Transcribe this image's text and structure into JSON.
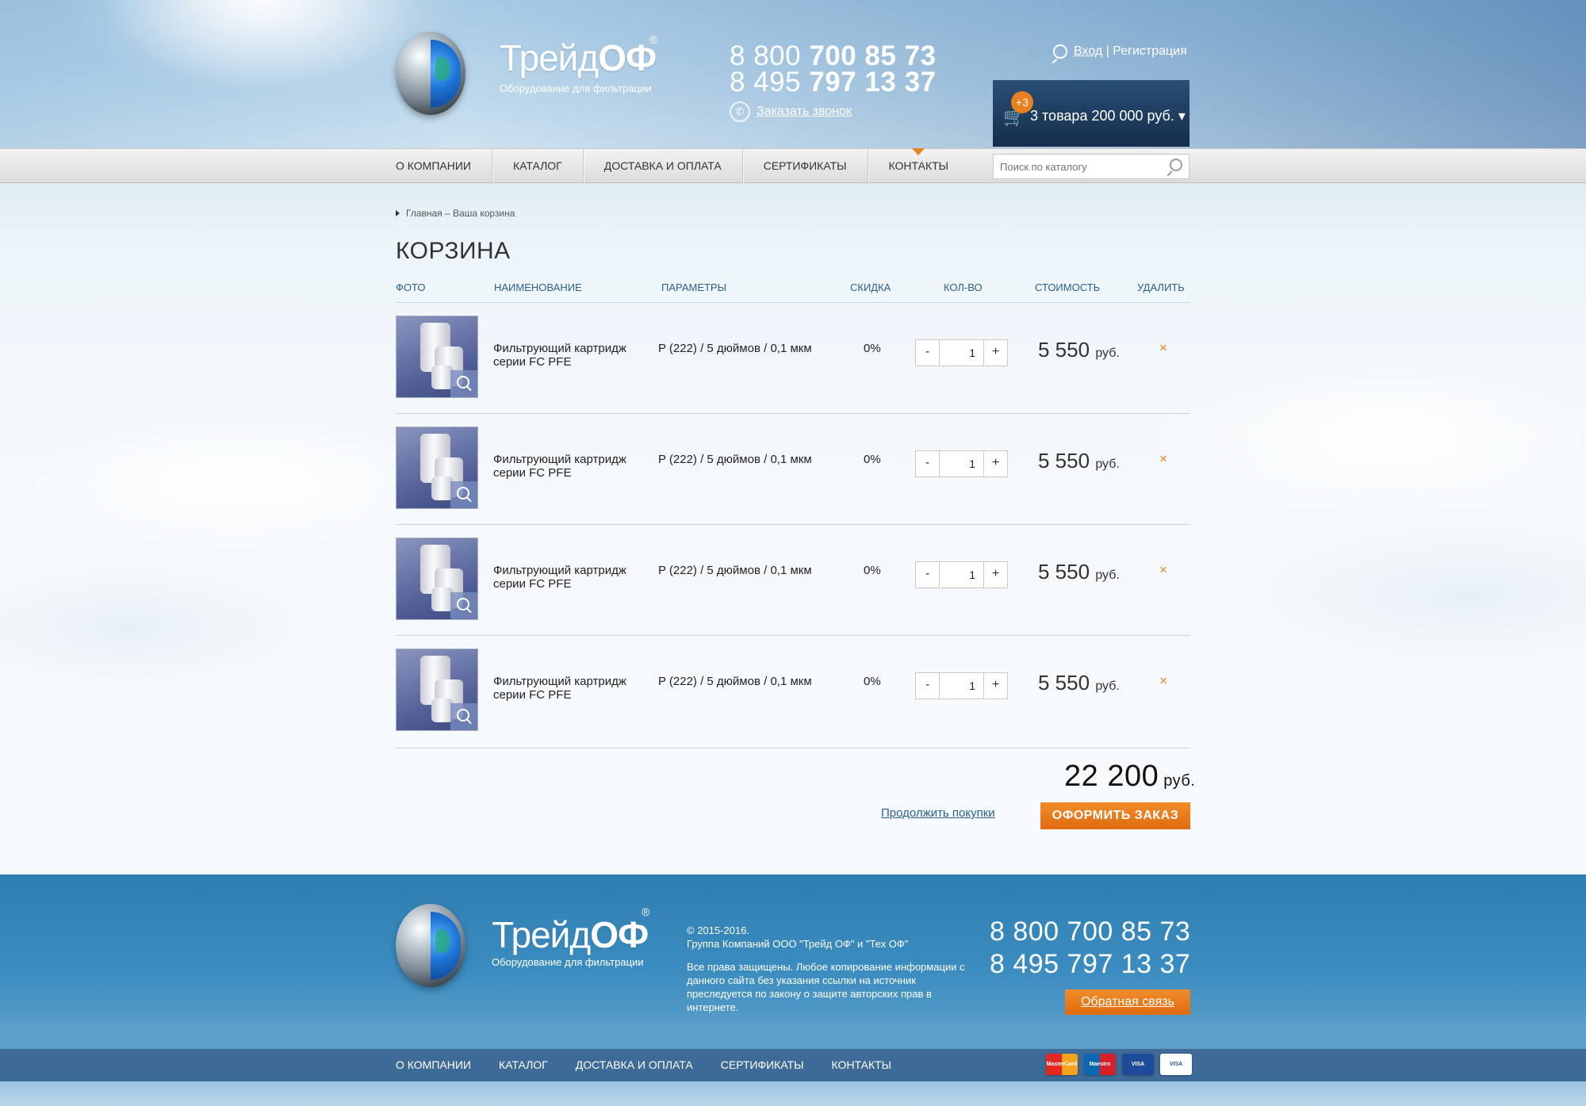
{
  "header": {
    "logo": {
      "brand_light": "Трейд",
      "brand_bold": "ОФ",
      "reg": "®",
      "subtitle": "Оборудование для фильтрации"
    },
    "phones": [
      {
        "light": "8 800 ",
        "bold": "700 85 73"
      },
      {
        "light": "8 495 ",
        "bold": "797 13 37"
      }
    ],
    "callback_label": "Заказать звонок",
    "auth": {
      "login": "Вход",
      "separator": " | ",
      "register": "Регистрация"
    },
    "cart": {
      "badge": "+3",
      "summary": "3 товара 200 000 руб. ▾"
    }
  },
  "nav": {
    "items": [
      "О КОМПАНИИ",
      "КАТАЛОГ",
      "ДОСТАВКА И ОПЛАТА",
      "СЕРТИФИКАТЫ",
      "КОНТАКТЫ"
    ],
    "active": "КОНТАКТЫ",
    "search_placeholder": "Поиск по каталогу"
  },
  "breadcrumb": "Главная – Ваша корзина",
  "page_title": "КОРЗИНА",
  "table": {
    "headers": [
      "ФОТО",
      "НАИМЕНОВАНИЕ",
      "ПАРАМЕТРЫ",
      "СКИДКА",
      "КОЛ-ВО",
      "СТОИМОСТЬ",
      "УДАЛИТЬ"
    ],
    "rows": [
      {
        "name": "Фильтрующий картридж серии FC PFE",
        "params": "P (222) / 5 дюймов / 0,1 мкм",
        "discount": "0%",
        "qty": "1",
        "price": "5 550",
        "currency": "руб.",
        "delete": "×"
      },
      {
        "name": "Фильтрующий картридж серии FC PFE",
        "params": "P (222) / 5 дюймов / 0,1 мкм",
        "discount": "0%",
        "qty": "1",
        "price": "5 550",
        "currency": "руб.",
        "delete": "×"
      },
      {
        "name": "Фильтрующий картридж серии FC PFE",
        "params": "P (222) / 5 дюймов / 0,1 мкм",
        "discount": "0%",
        "qty": "1",
        "price": "5 550",
        "currency": "руб.",
        "delete": "×"
      },
      {
        "name": "Фильтрующий картридж серии FC PFE",
        "params": "P (222) / 5 дюймов / 0,1 мкм",
        "discount": "0%",
        "qty": "1",
        "price": "5 550",
        "currency": "руб.",
        "delete": "×"
      }
    ],
    "minus": "-",
    "plus": "+"
  },
  "summary": {
    "total": "22 200",
    "currency": "руб.",
    "continue": "Продолжить покупки",
    "order": "ОФОРМИТЬ ЗАКАЗ"
  },
  "footer": {
    "copyright": "© 2015-2016.",
    "company": "Группа Компаний ООО \"Трейд ОФ\" и \"Тех ОФ\"",
    "rights": "Все права защищены. Любое копирование информации с данного сайта без указания ссылки на источник преследуется по закону о защите авторских прав в интернете.",
    "phones": [
      "8 800 700 85 73",
      "8 495 797 13 37"
    ],
    "feedback": "Обратная связь",
    "nav": [
      "О КОМПАНИИ",
      "КАТАЛОГ",
      "ДОСТАВКА И ОПЛАТА",
      "СЕРТИФИКАТЫ",
      "КОНТАКТЫ"
    ],
    "cards": [
      "MasterCard",
      "Maestro",
      "VISA Electron",
      "VISA"
    ]
  },
  "colors": {
    "accent": "#e9801f",
    "nav_link": "#2a5f8d",
    "footer": "#2f7eb2"
  }
}
